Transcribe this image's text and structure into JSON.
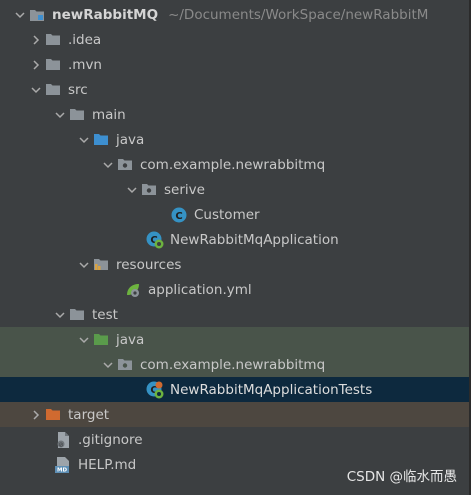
{
  "tree": {
    "project_name": "newRabbitMQ",
    "project_path": "~/Documents/WorkSpace/newRabbitM",
    "nodes": [
      {
        "label": ".idea",
        "icon": "folder-icon"
      },
      {
        "label": ".mvn",
        "icon": "folder-icon"
      },
      {
        "label": "src",
        "icon": "folder-icon"
      },
      {
        "label": "main",
        "icon": "folder-icon"
      },
      {
        "label": "java",
        "icon": "source-folder-icon"
      },
      {
        "label": "com.example.newrabbitmq",
        "icon": "package-icon"
      },
      {
        "label": "serive",
        "icon": "package-icon"
      },
      {
        "label": "Customer",
        "icon": "class-icon"
      },
      {
        "label": "NewRabbitMqApplication",
        "icon": "spring-class-icon"
      },
      {
        "label": "resources",
        "icon": "resources-folder-icon"
      },
      {
        "label": "application.yml",
        "icon": "spring-yml-icon"
      },
      {
        "label": "test",
        "icon": "folder-icon"
      },
      {
        "label": "java",
        "icon": "test-folder-icon"
      },
      {
        "label": "com.example.newrabbitmq",
        "icon": "package-icon"
      },
      {
        "label": "NewRabbitMqApplicationTests",
        "icon": "spring-test-class-icon"
      },
      {
        "label": "target",
        "icon": "excluded-folder-icon"
      },
      {
        "label": ".gitignore",
        "icon": "gitignore-file-icon"
      },
      {
        "label": "HELP.md",
        "icon": "markdown-file-icon"
      }
    ]
  },
  "watermark": "CSDN @临水而愚",
  "colors": {
    "background": "#3c3f41",
    "selection": "#0d293e",
    "test_highlight": "#49544a",
    "excluded_highlight": "#4d4740",
    "folder": "#8c9399",
    "source_folder": "#3d8fd0",
    "test_folder": "#5a9b4b",
    "excluded_folder": "#d06a30",
    "class_icon": "#3592c4"
  }
}
